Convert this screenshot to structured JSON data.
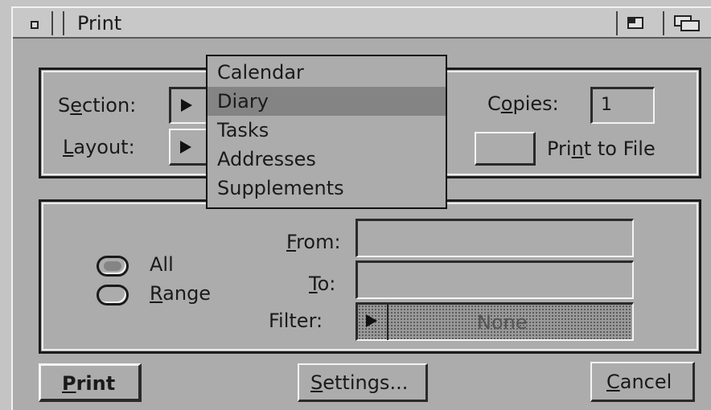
{
  "window": {
    "title": "Print"
  },
  "titlebar": {
    "close_icon": "close-box-icon",
    "depth_icon": "depth-gadget-icon",
    "zoom_icon": "zoom-gadget-icon"
  },
  "top_panel": {
    "section_label": "Section:",
    "layout_label": "Layout:",
    "copies_label": "Copies:",
    "copies_value": "1",
    "print_to_file_label": "Print to File"
  },
  "section_menu": {
    "items": [
      "Calendar",
      "Diary",
      "Tasks",
      "Addresses",
      "Supplements"
    ],
    "selected": "Diary"
  },
  "range_panel": {
    "all_label": "All",
    "range_label": "Range",
    "from_label": "From:",
    "from_value": "",
    "to_label": "To:",
    "to_value": "",
    "filter_label": "Filter:",
    "filter_value": "None",
    "selected_option": "All"
  },
  "buttons": {
    "print": "Print",
    "settings": "Settings...",
    "cancel": "Cancel"
  },
  "colors": {
    "window_bg": "#acacac",
    "selection": "#848484",
    "dark_edge": "#1c1c1c",
    "light_edge": "#f4f4f4"
  }
}
